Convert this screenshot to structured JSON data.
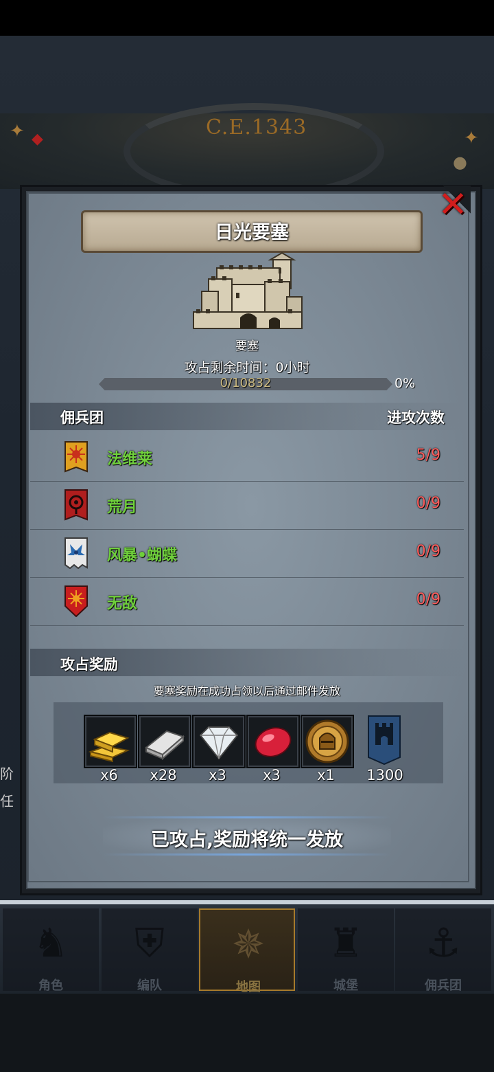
{
  "era": {
    "text": "C.E.1343"
  },
  "modal": {
    "title": "日光要塞",
    "building_type": "要塞",
    "time_label": "攻占剩余时间：0小时",
    "progress": {
      "current": 0,
      "total": 10832,
      "label": "0/10832",
      "percent_label": "0%"
    }
  },
  "mercenaries": {
    "header": "佣兵团",
    "attacks_header": "进攻次数",
    "rows": [
      {
        "name": "法维莱",
        "count": "5/9",
        "banner_color": "#e0a020",
        "banner_icon": "sun-emblem"
      },
      {
        "name": "荒月",
        "count": "0/9",
        "banner_color": "#b01e1e",
        "banner_icon": "eye-emblem"
      },
      {
        "name": "风暴•蝴蝶",
        "count": "0/9",
        "banner_color": "#e8e8e8",
        "banner_icon": "butterfly-emblem"
      },
      {
        "name": "无敌",
        "count": "0/9",
        "banner_color": "#c81e1e",
        "banner_icon": "sun-emblem"
      }
    ]
  },
  "rewards": {
    "header": "攻占奖励",
    "note": "要塞奖励在成功占领以后通过邮件发放",
    "items": [
      {
        "icon": "gold-bars-icon",
        "count": "x6"
      },
      {
        "icon": "silver-ingot-icon",
        "count": "x28"
      },
      {
        "icon": "diamond-icon",
        "count": "x3"
      },
      {
        "icon": "ruby-icon",
        "count": "x3"
      },
      {
        "icon": "knight-medal-icon",
        "count": "x1"
      },
      {
        "icon": "castle-banner-icon",
        "count": "1300"
      }
    ]
  },
  "claim_button": {
    "label": "已攻占,奖励将统一发放"
  },
  "nav": {
    "items": [
      {
        "label": "角色",
        "icon": "knight-icon",
        "active": false
      },
      {
        "label": "编队",
        "icon": "helmet-icon",
        "active": false
      },
      {
        "label": "地图",
        "icon": "compass-icon",
        "active": true
      },
      {
        "label": "城堡",
        "icon": "castle-icon",
        "active": false
      },
      {
        "label": "佣兵团",
        "icon": "ship-icon",
        "active": false
      }
    ]
  },
  "side_peek": {
    "line1": "阶",
    "line2": "任"
  },
  "colors": {
    "merc_name": "#6fcf3c",
    "attack_count": "#ff5c5c",
    "progress_fill": "#c9a640",
    "close_red": "#d11d1d"
  }
}
